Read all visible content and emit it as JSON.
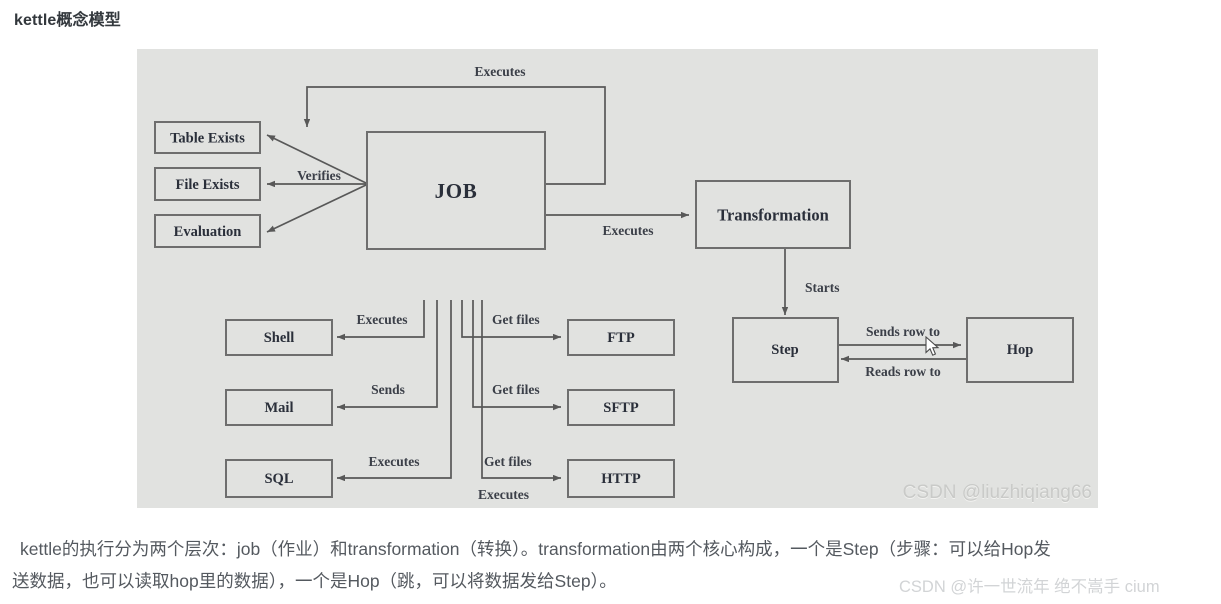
{
  "page": {
    "title": "kettle概念模型"
  },
  "diagram": {
    "nodes": {
      "job": "JOB",
      "transformation": "Transformation",
      "table_exists": "Table Exists",
      "file_exists": "File Exists",
      "evaluation": "Evaluation",
      "shell": "Shell",
      "mail": "Mail",
      "sql": "SQL",
      "ftp": "FTP",
      "sftp": "SFTP",
      "http": "HTTP",
      "step": "Step",
      "hop": "Hop"
    },
    "edge_labels": {
      "job_self_executes": "Executes",
      "verifies": "Verifies",
      "job_to_transformation": "Executes",
      "transformation_to_step": "Starts",
      "step_to_hop": "Sends row to",
      "hop_to_step": "Reads row to",
      "job_to_shell": "Executes",
      "job_to_mail": "Sends",
      "job_to_sql": "Executes",
      "job_to_ftp": "Get files",
      "job_to_sftp": "Get files",
      "job_to_http": "Get files",
      "job_to_http_executes": "Executes"
    },
    "watermark": "CSDN @liuzhiqiang66",
    "colors": {
      "panel_background": "#e1e2e0",
      "node_stroke": "#6e6e6e",
      "edge_stroke": "#585858",
      "label_text": "#2a2f3a"
    }
  },
  "caption": {
    "line1": "kettle的执行分为两个层次：job（作业）和transformation（转换）。transformation由两个核心构成，一个是Step（步骤：可以给Hop发",
    "line2": "送数据，也可以读取hop里的数据），一个是Hop（跳，可以将数据发给Step）。"
  },
  "bottom_watermark": {
    "text": "CSDN @许一世流年 绝不嵩手 cium"
  }
}
